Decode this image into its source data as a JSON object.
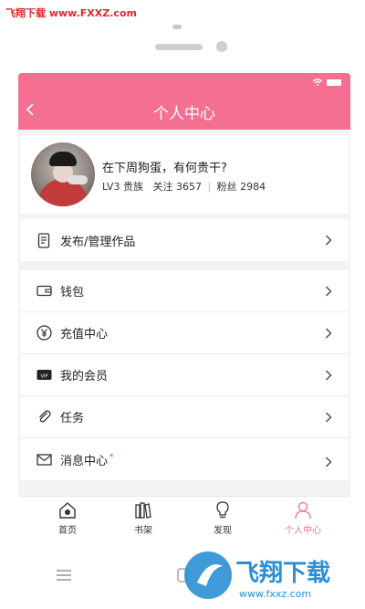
{
  "watermark": {
    "top_text": "飞翔下载 www.FXXZ.com",
    "logo_text": "飞翔下载",
    "logo_url": "www.fxxz.com"
  },
  "header": {
    "title": "个人中心"
  },
  "profile": {
    "name": "在下周狗蛋，有何贵干?",
    "level": "LV3 贵族",
    "follow": "关注 3657",
    "separator": "|",
    "fans": "粉丝 2984"
  },
  "menu_top": [
    {
      "label": "发布/管理作品",
      "icon": "document-icon"
    }
  ],
  "menu_main": [
    {
      "label": "钱包",
      "icon": "wallet-icon"
    },
    {
      "label": "充值中心",
      "icon": "yen-icon"
    },
    {
      "label": "我的会员",
      "icon": "vip-card-icon"
    },
    {
      "label": "任务",
      "icon": "paperclip-icon"
    },
    {
      "label": "消息中心",
      "icon": "mail-icon",
      "badge": "*"
    }
  ],
  "tabbar": [
    {
      "label": "首页",
      "icon": "home-icon"
    },
    {
      "label": "书架",
      "icon": "bookshelf-icon"
    },
    {
      "label": "发现",
      "icon": "lightbulb-icon"
    },
    {
      "label": "个人中心",
      "icon": "person-icon",
      "active": true
    }
  ],
  "colors": {
    "accent": "#f56f93",
    "watermark": "#e0282c",
    "logo_blue": "#2a8fd6"
  }
}
